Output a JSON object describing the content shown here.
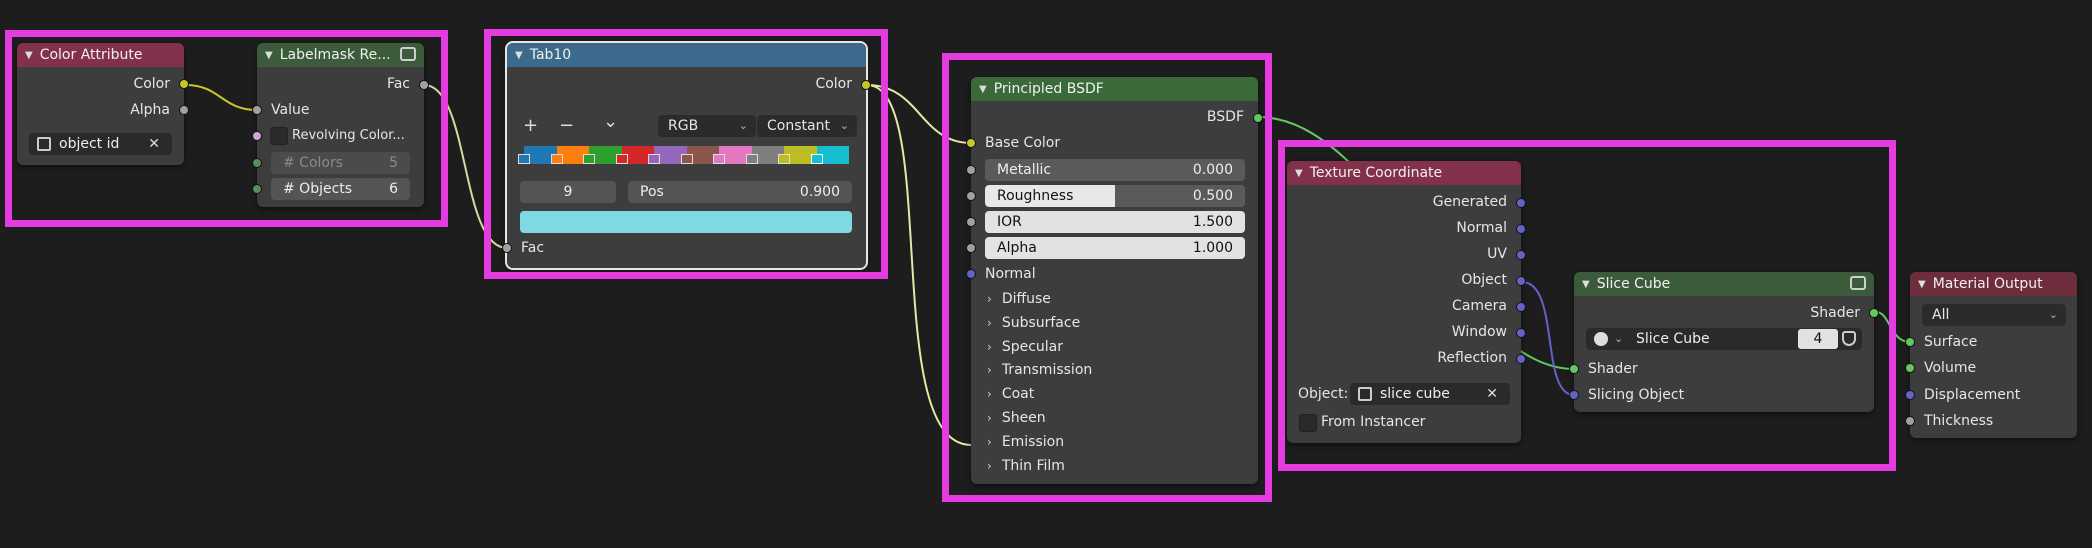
{
  "nodes": {
    "color_attribute": {
      "title": "Color Attribute",
      "outputs": [
        "Color",
        "Alpha"
      ],
      "attr_value": "object id"
    },
    "labelmask": {
      "title": "Labelmask Re...",
      "output": "Fac",
      "input_value": "Value",
      "checkbox_label": "Revolving Color...",
      "colors_label": "# Colors",
      "colors_value": "5",
      "objects_label": "# Objects",
      "objects_value": "6"
    },
    "tab10": {
      "title": "Tab10",
      "output": "Color",
      "mode": "RGB",
      "interpolation": "Constant",
      "add_btn": "+",
      "remove_btn": "−",
      "menu_btn": "⌄",
      "stop_index": "9",
      "pos_label": "Pos",
      "pos_value": "0.900",
      "input": "Fac",
      "ramp_colors": [
        "#1f77b4",
        "#ff7f0e",
        "#2ca02c",
        "#d62728",
        "#9467bd",
        "#8c564b",
        "#e377c2",
        "#7f7f7f",
        "#bcbd22",
        "#17becf"
      ],
      "active_color": "#7fd9e3"
    },
    "principled": {
      "title": "Principled BSDF",
      "output": "BSDF",
      "base_color": "Base Color",
      "metallic_label": "Metallic",
      "metallic_value": "0.000",
      "roughness_label": "Roughness",
      "roughness_value": "0.500",
      "roughness_fraction": 0.5,
      "ior_label": "IOR",
      "ior_value": "1.500",
      "alpha_label": "Alpha",
      "alpha_value": "1.000",
      "normal": "Normal",
      "panels": [
        "Diffuse",
        "Subsurface",
        "Specular",
        "Transmission",
        "Coat",
        "Sheen",
        "Emission",
        "Thin Film"
      ]
    },
    "texture_coordinate": {
      "title": "Texture Coordinate",
      "outputs": [
        "Generated",
        "Normal",
        "UV",
        "Object",
        "Camera",
        "Window",
        "Reflection"
      ],
      "object_label": "Object:",
      "object_value": "slice cube",
      "from_instancer": "From Instancer"
    },
    "slice_cube": {
      "title": "Slice Cube",
      "output": "Shader",
      "group_name": "Slice Cube",
      "user_count": "4",
      "inputs": [
        "Shader",
        "Slicing Object"
      ]
    },
    "material_output": {
      "title": "Material Output",
      "target": "All",
      "inputs": [
        "Surface",
        "Volume",
        "Displacement",
        "Thickness"
      ]
    }
  },
  "colors": {
    "highlight": "#e43ce0",
    "background": "#1d1d1d",
    "node_body": "#3d3d3d"
  }
}
